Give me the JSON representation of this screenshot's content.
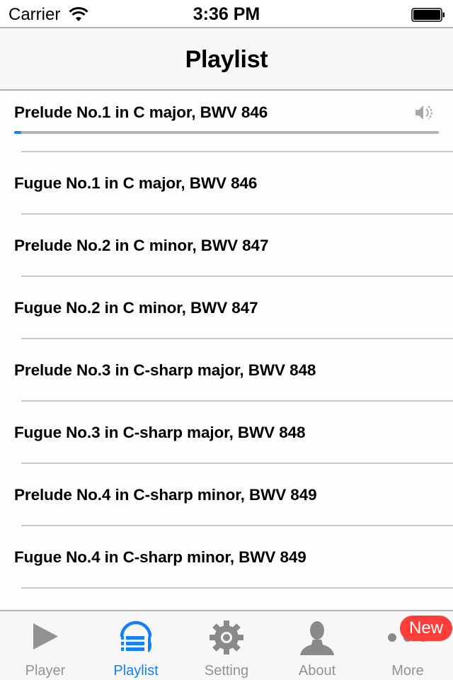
{
  "status_bar": {
    "carrier": "Carrier",
    "time": "3:36 PM",
    "wifi_icon": "wifi-icon",
    "battery_icon": "battery-full-icon"
  },
  "nav_bar": {
    "title": "Playlist"
  },
  "playlist": {
    "now_playing": {
      "title": "Prelude No.1 in C major, BWV 846",
      "icon": "speaker-icon",
      "progress_fraction": 0.017
    },
    "items": [
      {
        "title": "Fugue No.1 in C major, BWV 846"
      },
      {
        "title": "Prelude No.2 in C minor, BWV 847"
      },
      {
        "title": "Fugue No.2 in C minor, BWV 847"
      },
      {
        "title": "Prelude No.3 in C-sharp major, BWV 848"
      },
      {
        "title": "Fugue No.3 in C-sharp major, BWV 848"
      },
      {
        "title": "Prelude No.4 in C-sharp minor, BWV 849"
      },
      {
        "title": "Fugue No.4 in C-sharp minor, BWV 849"
      }
    ]
  },
  "tab_bar": {
    "active_color": "#147efb",
    "inactive_color": "#929292",
    "tabs": [
      {
        "label": "Player",
        "icon": "play-icon",
        "active": false
      },
      {
        "label": "Playlist",
        "icon": "playlist-headphones-icon",
        "active": true
      },
      {
        "label": "Setting",
        "icon": "gear-icon",
        "active": false
      },
      {
        "label": "About",
        "icon": "person-icon",
        "active": false
      },
      {
        "label": "More",
        "icon": "more-dots-icon",
        "active": false,
        "badge": "New"
      }
    ]
  }
}
